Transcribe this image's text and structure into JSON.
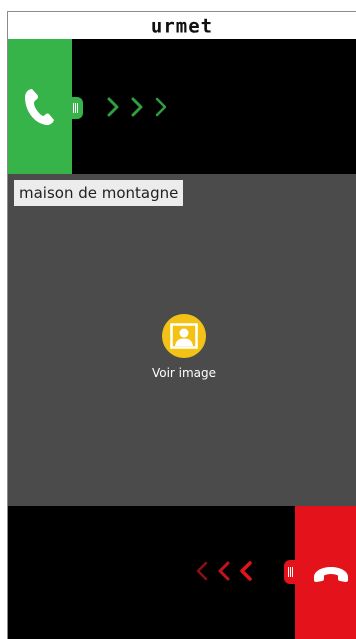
{
  "brand": {
    "logo_text": "urmet"
  },
  "call": {
    "location_label": "maison de montagne",
    "view_image_label": "Voir image"
  },
  "controls": {
    "answer_icon": "phone-answer-icon",
    "hangup_icon": "phone-hangup-icon",
    "view_image_icon": "portrait-icon"
  },
  "colors": {
    "answer_green": "#36b44a",
    "hangup_red": "#e3121b",
    "view_image_yellow": "#f2c316",
    "video_background": "#4b4b4b"
  }
}
